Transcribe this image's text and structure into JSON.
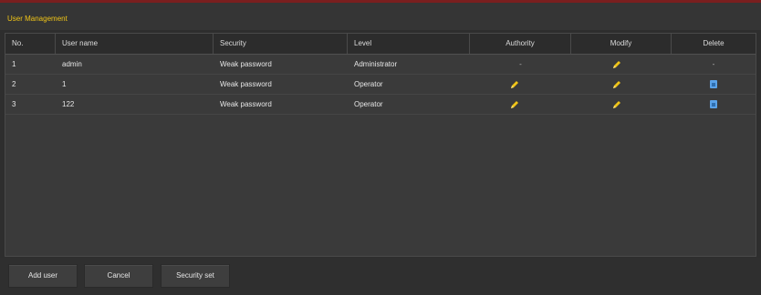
{
  "window": {
    "title": "User Management"
  },
  "table": {
    "columns": [
      "No.",
      "User name",
      "Security",
      "Level",
      "Authority",
      "Modify",
      "Delete"
    ],
    "rows": [
      {
        "no": "1",
        "user": "admin",
        "security": "Weak password",
        "level": "Administrator",
        "authority": "-",
        "modify": "pencil-icon",
        "delete": "-"
      },
      {
        "no": "2",
        "user": "1",
        "security": "Weak password",
        "level": "Operator",
        "authority": "pencil-icon",
        "modify": "pencil-icon",
        "delete": "trash-icon"
      },
      {
        "no": "3",
        "user": "122",
        "security": "Weak password",
        "level": "Operator",
        "authority": "pencil-icon",
        "modify": "pencil-icon",
        "delete": "trash-icon"
      }
    ]
  },
  "footer": {
    "add_user": "Add user",
    "cancel": "Cancel",
    "security_set": "Security set"
  },
  "colors": {
    "title": "#f0c417",
    "pencil": "#f0c417",
    "trash": "#5aa2e8"
  }
}
